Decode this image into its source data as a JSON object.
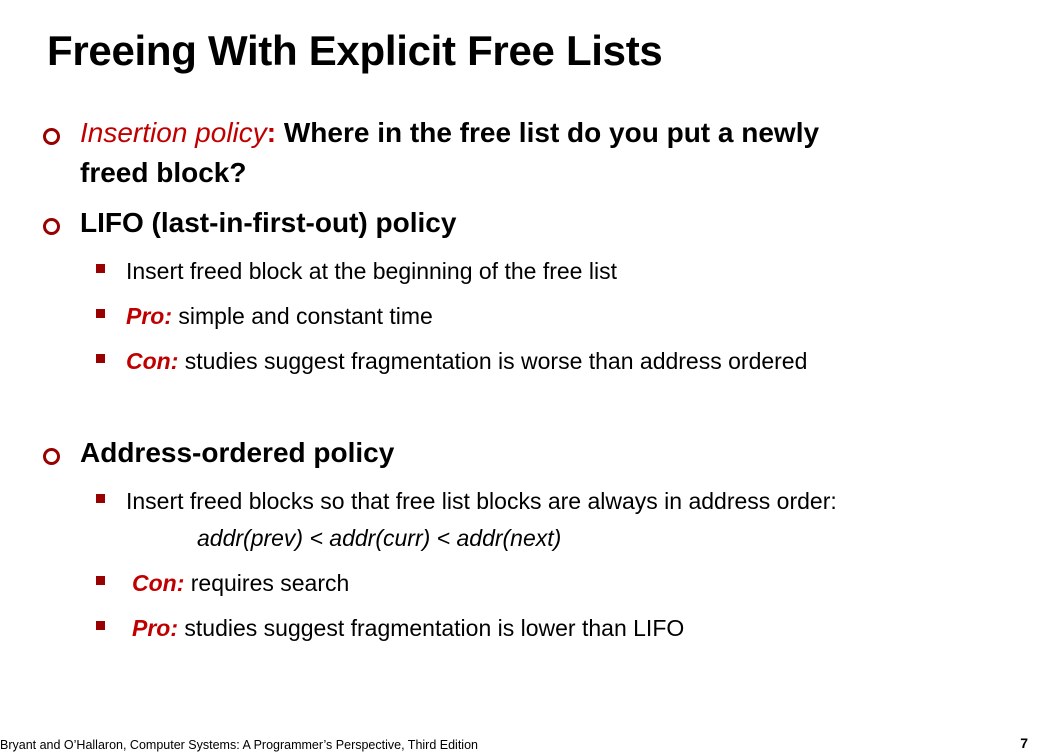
{
  "slide": {
    "title": "Freeing With Explicit Free Lists",
    "insertion": {
      "term": "Insertion policy",
      "colon": ":",
      "text_line1": " Where in the free list do you put a newly",
      "text_line2": "freed block?"
    },
    "lifo": {
      "heading": "LIFO (last-in-first-out) policy",
      "items": [
        {
          "label": "",
          "text": "Insert freed block at the beginning of the free list"
        },
        {
          "label": "Pro:",
          "text": " simple and constant time"
        },
        {
          "label": "Con:",
          "text": " studies suggest fragmentation is worse than address ordered"
        }
      ]
    },
    "address": {
      "heading": "Address-ordered policy",
      "item1": "Insert freed blocks so that free list blocks are always in address order:",
      "formula": "addr(prev) < addr(curr) < addr(next)",
      "con_label": "Con:",
      "con_text": " requires search",
      "pro_label": "Pro:",
      "pro_text": " studies suggest fragmentation is lower than LIFO"
    },
    "footer": "Bryant and O’Hallaron, Computer Systems: A Programmer’s Perspective, Third Edition",
    "page_number": "7"
  }
}
